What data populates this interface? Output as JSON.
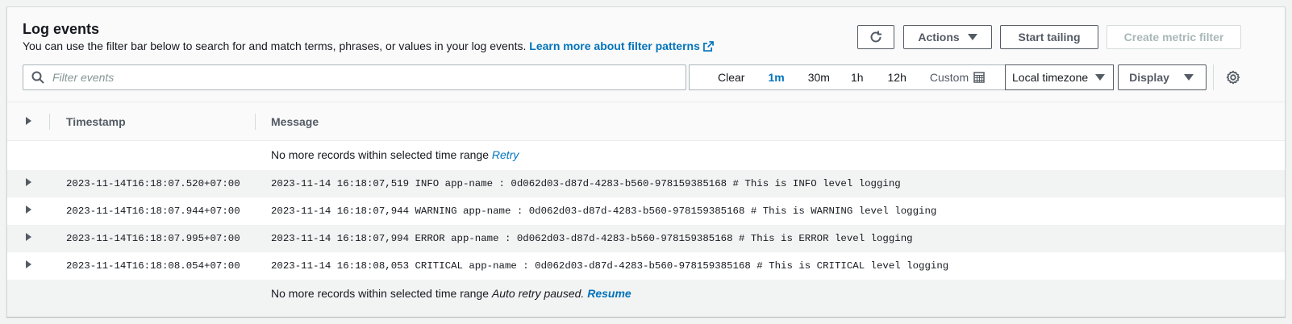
{
  "header": {
    "title": "Log events",
    "subtitle": "You can use the filter bar below to search for and match terms, phrases, or values in your log events.",
    "learn_more": "Learn more about filter patterns"
  },
  "toolbar": {
    "refresh_icon": "refresh-icon",
    "actions": "Actions",
    "start_tailing": "Start tailing",
    "create_metric_filter": "Create metric filter"
  },
  "filter": {
    "placeholder": "Filter events",
    "clear": "Clear",
    "ranges": [
      "1m",
      "30m",
      "1h",
      "12h"
    ],
    "active_range": "1m",
    "custom": "Custom",
    "timezone": "Local timezone",
    "display": "Display"
  },
  "table": {
    "columns": [
      "Timestamp",
      "Message"
    ],
    "top_note": {
      "text": "No more records within selected time range",
      "link": "Retry"
    },
    "rows": [
      {
        "timestamp": "2023-11-14T16:18:07.520+07:00",
        "message": "2023-11-14 16:18:07,519 INFO app-name : 0d062d03-d87d-4283-b560-978159385168 # This is INFO level logging"
      },
      {
        "timestamp": "2023-11-14T16:18:07.944+07:00",
        "message": "2023-11-14 16:18:07,944 WARNING app-name : 0d062d03-d87d-4283-b560-978159385168 # This is WARNING level logging"
      },
      {
        "timestamp": "2023-11-14T16:18:07.995+07:00",
        "message": "2023-11-14 16:18:07,994 ERROR app-name : 0d062d03-d87d-4283-b560-978159385168 # This is ERROR level logging"
      },
      {
        "timestamp": "2023-11-14T16:18:08.054+07:00",
        "message": "2023-11-14 16:18:08,053 CRITICAL app-name : 0d062d03-d87d-4283-b560-978159385168 # This is CRITICAL level logging"
      }
    ],
    "bottom_note": {
      "text": "No more records within selected time range",
      "paused": "Auto retry paused.",
      "link": "Resume"
    }
  },
  "colors": {
    "link": "#0073bb",
    "row_shade": "#f2f3f3",
    "border": "#545b64"
  }
}
